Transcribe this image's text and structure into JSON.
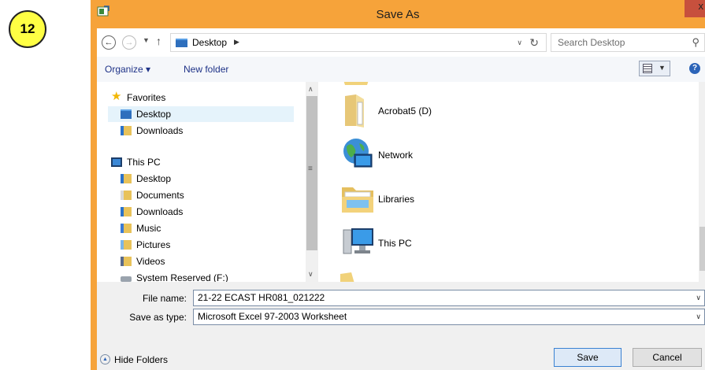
{
  "step_badge": "12",
  "window": {
    "title": "Save As",
    "close_label": "x"
  },
  "navigation": {
    "breadcrumb": "Desktop",
    "search_placeholder": "Search Desktop"
  },
  "toolbar": {
    "organize_label": "Organize ▾",
    "new_folder_label": "New folder"
  },
  "nav_pane": {
    "favorites": "Favorites",
    "fav_desktop": "Desktop",
    "fav_downloads": "Downloads",
    "this_pc": "This PC",
    "pc_desktop": "Desktop",
    "pc_documents": "Documents",
    "pc_downloads": "Downloads",
    "pc_music": "Music",
    "pc_pictures": "Pictures",
    "pc_videos": "Videos",
    "pc_system_reserved": "System Reserved (F:)"
  },
  "files": {
    "acrobat": "Acrobat5 (D)",
    "network": "Network",
    "libraries": "Libraries",
    "this_pc": "This PC"
  },
  "form": {
    "file_name_label": "File name:",
    "file_name_value": "21-22 ECAST HR081_021222",
    "save_type_label": "Save as type:",
    "save_type_value": "Microsoft Excel 97-2003 Worksheet"
  },
  "footer": {
    "hide_folders": "Hide Folders",
    "save_label": "Save",
    "cancel_label": "Cancel"
  }
}
